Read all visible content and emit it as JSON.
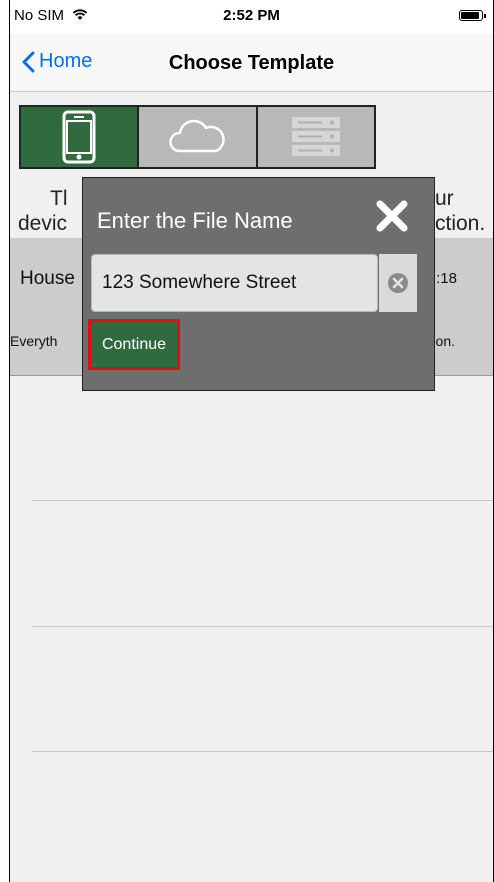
{
  "status_bar": {
    "carrier": "No SIM",
    "time": "2:52 PM"
  },
  "nav": {
    "back_label": "Home",
    "title": "Choose Template"
  },
  "segments": [
    {
      "icon": "phone-icon",
      "active": true
    },
    {
      "icon": "cloud-icon",
      "active": false
    },
    {
      "icon": "server-icon",
      "active": false
    }
  ],
  "description": {
    "left_line1": "Tl",
    "left_line2": "devic",
    "right_line1": "ur",
    "right_line2": "ction."
  },
  "template_item": {
    "name": "House",
    "time": ":18",
    "desc_left": "Everyth",
    "desc_right": "on."
  },
  "dialog": {
    "title": "Enter the File Name",
    "input_value": "123 Somewhere Street",
    "continue_label": "Continue"
  },
  "colors": {
    "accent": "#0a6cf0",
    "active_segment": "#2f6b3f",
    "dialog_bg": "#6e6e6e",
    "highlight": "#e01010"
  }
}
